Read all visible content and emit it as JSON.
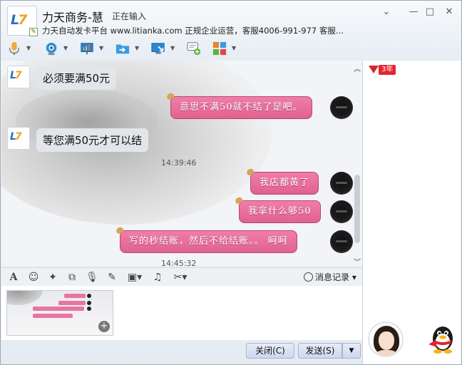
{
  "window": {
    "contact_name": "力天商务-慧",
    "typing_status": "正在输入",
    "signature": "力天自动发卡平台 www.litianka.com 正规企业运营，客服4006-991-977 客服...",
    "controls": {
      "dropdown": "⌄",
      "minimize": "—",
      "maximize": "□",
      "close": "✕"
    },
    "logo_text": {
      "l": "L",
      "t": "7"
    }
  },
  "toolbar": {
    "items": [
      {
        "name": "voice-call",
        "icon": "microphone-icon",
        "color": "#f2a93b"
      },
      {
        "name": "video-call",
        "icon": "webcam-icon",
        "color": "#2f8fd6"
      },
      {
        "name": "remote-desktop",
        "icon": "presentation-icon",
        "color": "#2d7fd0"
      },
      {
        "name": "send-file",
        "icon": "folder-arrow-icon",
        "color": "#3a9be0"
      },
      {
        "name": "screen-share",
        "icon": "monitor-arrow-icon",
        "color": "#2a86d6"
      },
      {
        "name": "new-chat",
        "icon": "chat-add-icon",
        "color": "#5fb03c"
      },
      {
        "name": "apps",
        "icon": "apps-grid-icon",
        "color": "#e8852e"
      }
    ]
  },
  "chat": {
    "messages": [
      {
        "dir": "in",
        "text": "必须要满50元"
      },
      {
        "dir": "out",
        "text": "意思不满50就不结了是吧。"
      },
      {
        "dir": "in",
        "text": "等您满50元才可以结"
      },
      {
        "dir": "time",
        "text": "14:39:46"
      },
      {
        "dir": "out",
        "text": "我店都黄了"
      },
      {
        "dir": "out",
        "text": "我拿什么够50"
      },
      {
        "dir": "out",
        "text": "写的秒结账，然后不给结账。。 呵呵"
      },
      {
        "dir": "time",
        "text": "14:45:32"
      }
    ]
  },
  "input_toolbar": {
    "font_label": "A",
    "icons": [
      "font-icon",
      "emoji-icon",
      "magic-wand-icon",
      "screenshot-icon",
      "voice-message-icon",
      "edit-icon",
      "image-icon",
      "music-icon",
      "scissors-icon"
    ],
    "history_label": "消息记录"
  },
  "buttons": {
    "close_label": "关闭(C)",
    "send_label": "发送(S)"
  },
  "right_panel": {
    "year_badge": "3年"
  }
}
